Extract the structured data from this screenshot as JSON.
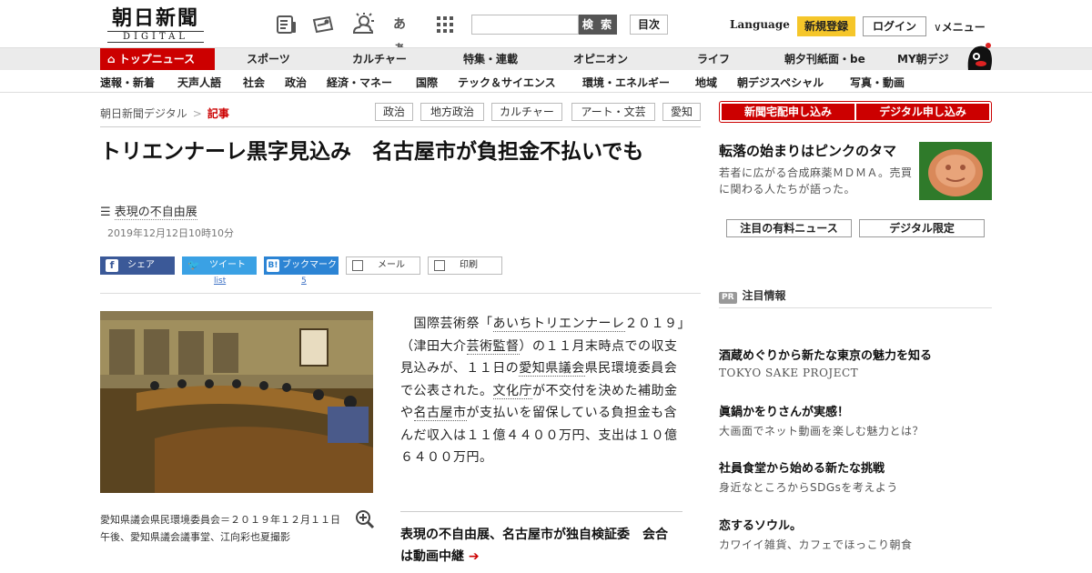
{
  "header": {
    "logo_main": "朝日新聞",
    "logo_sub": "DIGITAL",
    "icon_hiragana": "あぁ",
    "search_button": "検 索",
    "mokuji_button": "目次",
    "language_link": "Language",
    "register_button": "新規登録",
    "login_button": "ログイン",
    "menu_link": "メニュー"
  },
  "main_nav": {
    "top_news": "トップニュース",
    "items": [
      "スポーツ",
      "カルチャー",
      "特集・連載",
      "オピニオン",
      "ライフ",
      "朝夕刊紙面・be",
      "MY朝デジ"
    ]
  },
  "sub_nav": {
    "items": [
      "速報・新着",
      "天声人語",
      "社会",
      "政治",
      "経済・マネー",
      "国際",
      "テック＆サイエンス",
      "環境・エネルギー",
      "地域",
      "朝デジスペシャル",
      "写真・動画"
    ]
  },
  "breadcrumb": {
    "home": "朝日新聞デジタル",
    "separator": ">",
    "current": "記事"
  },
  "tags": [
    "政治",
    "地方政治",
    "カルチャー",
    "アート・文芸",
    "愛知"
  ],
  "article": {
    "headline": "トリエンナーレ黒字見込み　名古屋市が負担金不払いでも",
    "series": "表現の不自由展",
    "date": "2019年12月12日10時10分",
    "share": {
      "facebook": "シェア",
      "twitter": "ツイート",
      "twitter_count": "list",
      "hatena": "ブックマーク",
      "hatena_count": "5",
      "mail": "メール",
      "print": "印刷"
    },
    "caption": "愛知県議会県民環境委員会＝２０１９年１２月１１日午後、愛知県議会議事堂、江向彩也夏撮影",
    "body": {
      "p1": "国際芸術祭「",
      "link1": "あいちトリエンナーレ",
      "p2": "２０１９」（津田大介",
      "link2": "芸術監督",
      "p3": "）の１１月末時点での収支見込みが、１１日の",
      "link3": "愛知県議会",
      "p4": "県民環境委員会で公表された。",
      "link4": "文化庁",
      "p5": "が不交付を決めた補助金や",
      "link5": "名古屋市",
      "p6": "が支払いを留保している負担金も含んだ収入は１１億４４００万円、支出は１０億６４００万円。"
    },
    "related": "表現の不自由展、名古屋市が独自検証委　会合は動画中継"
  },
  "right": {
    "apply_home": "新聞宅配申し込み",
    "apply_digital": "デジタル申し込み",
    "feature_title": "転落の始まりはピンクのタマ",
    "feature_desc": "若者に広がる合成麻薬ＭＤＭＡ。売買に関わる人たちが語った。",
    "tab_paid": "注目の有料ニュース",
    "tab_digital": "デジタル限定",
    "pr_badge": "PR",
    "pr_heading": "注目情報",
    "pr_items": [
      {
        "title": "酒蔵めぐりから新たな東京の魅力を知る",
        "sub": "TOKYO SAKE PROJECT"
      },
      {
        "title": "眞鍋かをりさんが実感！",
        "sub": "大画面でネット動画を楽しむ魅力とは？"
      },
      {
        "title": "社員食堂から始める新たな挑戦",
        "sub": "身近なところからSDGsを考えよう"
      },
      {
        "title": "恋するソウル。",
        "sub": "カワイイ雑貨、カフェでほっこり朝食"
      }
    ]
  }
}
